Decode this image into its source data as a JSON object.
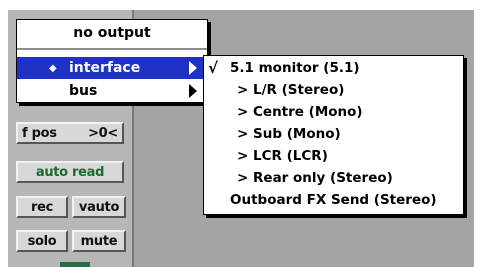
{
  "output_menu": {
    "items": [
      {
        "label": "no output",
        "highlighted": false,
        "has_submenu": false
      },
      {
        "label": "interface",
        "highlighted": true,
        "has_submenu": true,
        "marker": "◆"
      },
      {
        "label": "bus",
        "highlighted": false,
        "has_submenu": true
      }
    ]
  },
  "interface_submenu": {
    "items": [
      {
        "label": "5.1 monitor (5.1)",
        "checked": true,
        "check_mark": "√"
      },
      {
        "label": "> L/R (Stereo)",
        "checked": false
      },
      {
        "label": "> Centre (Mono)",
        "checked": false
      },
      {
        "label": "> Sub (Mono)",
        "checked": false
      },
      {
        "label": "> LCR (LCR)",
        "checked": false
      },
      {
        "label": "> Rear only (Stereo)",
        "checked": false
      },
      {
        "label": "Outboard FX Send (Stereo)",
        "checked": false
      }
    ]
  },
  "channel_strip": {
    "fpos_label": "f pos",
    "fpos_value": ">0<",
    "automation_mode": "auto read",
    "rec_label": "rec",
    "vauto_label": "vauto",
    "solo_label": "solo",
    "mute_label": "mute"
  },
  "colors": {
    "highlight": "#1e32c8",
    "automation_text": "#1b6b2c"
  }
}
